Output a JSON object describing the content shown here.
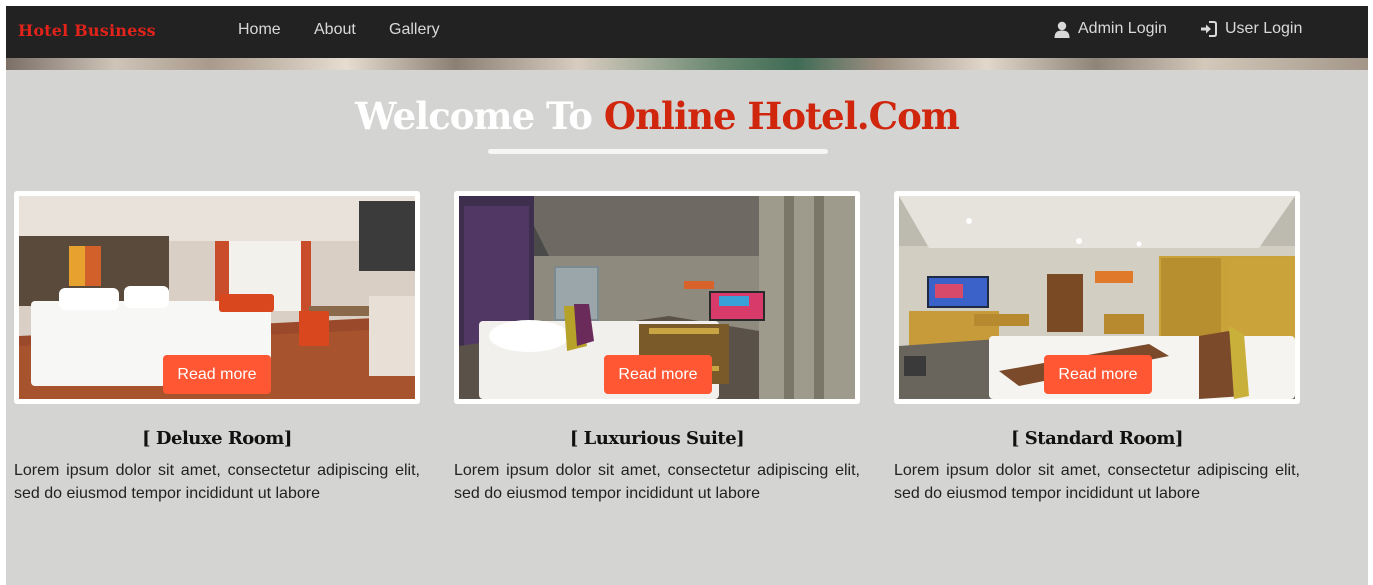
{
  "navbar": {
    "brand": "Hotel Business",
    "links": [
      {
        "label": "Home"
      },
      {
        "label": "About"
      },
      {
        "label": "Gallery"
      }
    ],
    "admin_login": {
      "label": "Admin Login",
      "icon": "user-icon"
    },
    "user_login": {
      "label": "User Login",
      "icon": "sign-in-icon"
    }
  },
  "welcome": {
    "prefix": "Welcome To",
    "highlight": "Online Hotel.Com"
  },
  "rooms": [
    {
      "title": "[ Deluxe Room]",
      "description": "Lorem ipsum dolor sit amet, consectetur adipiscing elit, sed do eiusmod tempor incididunt ut labore",
      "button": "Read more"
    },
    {
      "title": "[ Luxurious Suite]",
      "description": "Lorem ipsum dolor sit amet, consectetur adipiscing elit, sed do eiusmod tempor incididunt ut labore",
      "button": "Read more"
    },
    {
      "title": "[ Standard Room]",
      "description": "Lorem ipsum dolor sit amet, consectetur adipiscing elit, sed do eiusmod tempor incididunt ut labore",
      "button": "Read more"
    }
  ],
  "colors": {
    "navbar_bg": "#222222",
    "brand": "#e2231a",
    "page_bg": "#d4d4d2",
    "accent_heading": "#d0260e",
    "button": "#ff5733"
  }
}
